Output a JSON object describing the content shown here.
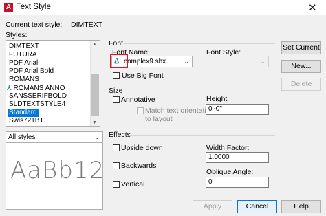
{
  "window": {
    "app_icon": "A",
    "title": "Text Style",
    "close_glyph": "✕"
  },
  "current_style": {
    "label": "Current text style:",
    "value": "DIMTEXT"
  },
  "styles": {
    "label": "Styles:",
    "items": [
      {
        "label": "DIMTEXT"
      },
      {
        "label": "FUTURA"
      },
      {
        "label": "PDF Arial"
      },
      {
        "label": "PDF Arial Bold"
      },
      {
        "label": "ROMANS"
      },
      {
        "label": "ROMANS ANNO",
        "annotative": true
      },
      {
        "label": "SANSSERIFBOLD"
      },
      {
        "label": "SLDTEXTSTYLE4"
      },
      {
        "label": "Standard",
        "selected": true
      },
      {
        "label": "Swis721BT"
      }
    ]
  },
  "filter": {
    "value": "All styles"
  },
  "preview": {
    "text": "AaBb12"
  },
  "font": {
    "group_label": "Font",
    "font_name_label": "Font Name:",
    "font_name_value": "complex9.shx",
    "font_style_label": "Font Style:",
    "font_style_value": "",
    "use_big_font_label": "Use Big Font"
  },
  "size": {
    "group_label": "Size",
    "annotative_label": "Annotative",
    "match_orientation_label_1": "Match text orientation",
    "match_orientation_label_2": "to layout",
    "height_label": "Height",
    "height_value": "0'-0\""
  },
  "effects": {
    "group_label": "Effects",
    "upside_down_label": "Upside down",
    "backwards_label": "Backwards",
    "vertical_label": "Vertical",
    "width_factor_label": "Width Factor:",
    "width_factor_value": "1.0000",
    "oblique_angle_label": "Oblique Angle:",
    "oblique_angle_value": "0"
  },
  "buttons": {
    "set_current": "Set Current",
    "new": "New...",
    "delete": "Delete",
    "apply": "Apply",
    "cancel": "Cancel",
    "help": "Help"
  },
  "colors": {
    "selection": "#0078d7",
    "highlight_box": "#e81123",
    "app_icon": "#c8102e"
  }
}
